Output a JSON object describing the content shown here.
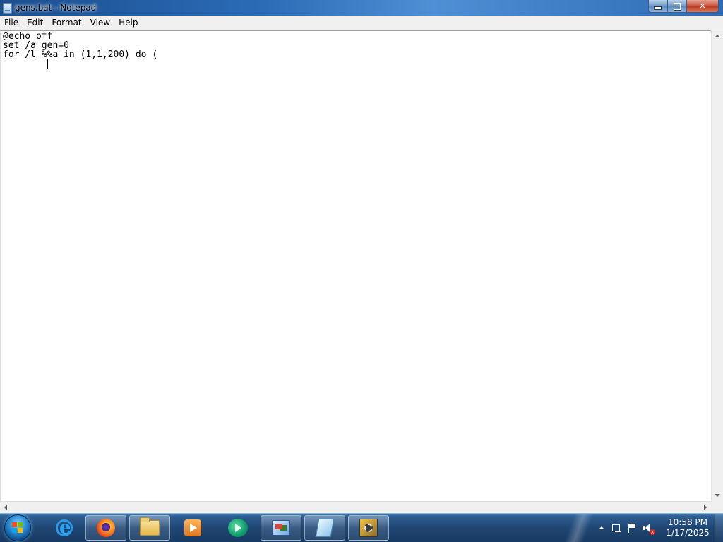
{
  "window": {
    "title": "gens.bat - Notepad",
    "app_icon": "notepad-icon"
  },
  "menu": {
    "items": [
      "File",
      "Edit",
      "Format",
      "View",
      "Help"
    ]
  },
  "editor": {
    "lines": [
      "@echo off",
      "set /a gen=0",
      "for /l %%a in (1,1,200) do ("
    ]
  },
  "taskbar": {
    "start": "windows-start-orb",
    "apps": [
      {
        "name": "internet-explorer-icon",
        "state": "pinned"
      },
      {
        "name": "firefox-icon",
        "state": "open"
      },
      {
        "name": "file-explorer-icon",
        "state": "open"
      },
      {
        "name": "media-player-icon",
        "state": "pinned"
      },
      {
        "name": "green-app-icon",
        "state": "pinned"
      },
      {
        "name": "remote-desktop-icon",
        "state": "open"
      },
      {
        "name": "notepad-icon",
        "state": "open"
      },
      {
        "name": "settings-app-icon",
        "state": "open"
      }
    ]
  },
  "tray": {
    "icons": [
      "show-hidden-icons",
      "network-icon",
      "action-center-flag-icon",
      "volume-muted-icon"
    ],
    "time": "10:58 PM",
    "date": "1/17/2025"
  },
  "colors": {
    "titlebar": "#2a6ab5",
    "taskbar": "#1f4673",
    "close_button": "#c7503a",
    "menubar": "#f0f0f0"
  }
}
